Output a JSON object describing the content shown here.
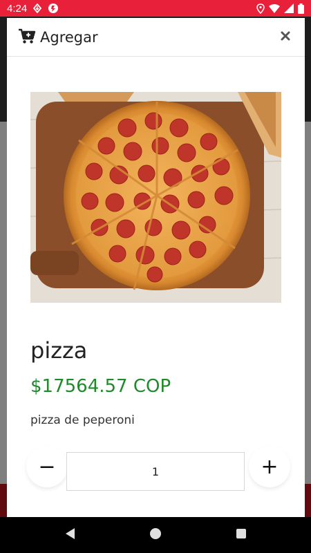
{
  "status_bar": {
    "time": "4:24",
    "icons": [
      "download-icon",
      "notification-app-icon",
      "location-icon",
      "wifi-icon",
      "signal-icon",
      "battery-icon"
    ],
    "color": "#e8203a"
  },
  "modal": {
    "title": "Agregar",
    "icon": "cart-plus-icon",
    "close_icon": "close-icon"
  },
  "product": {
    "image_alt": "pizza de peperoni",
    "name": "pizza",
    "price": "$17564.57 COP",
    "description": "pizza de peperoni",
    "price_color": "#1f8a2a"
  },
  "quantity": {
    "minus_label": "−",
    "plus_label": "+",
    "value": "1"
  },
  "nav_bar": {
    "icons": [
      "back-icon",
      "home-icon",
      "recents-icon"
    ]
  }
}
